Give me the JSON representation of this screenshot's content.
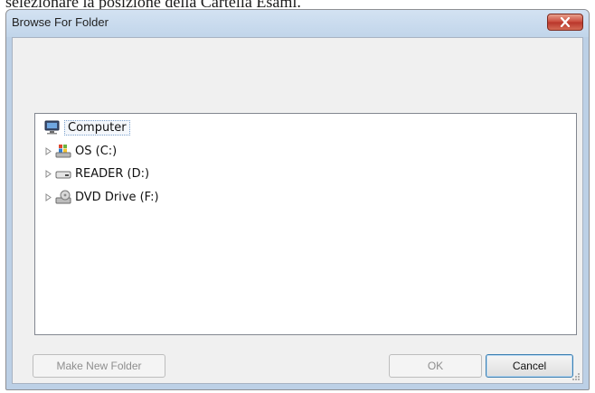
{
  "document": {
    "caption": "selezionare la posizione della Cartella Esami."
  },
  "dialog": {
    "title": "Browse For Folder",
    "tree": {
      "items": [
        {
          "label": "Computer",
          "icon": "computer-icon",
          "expandable": false,
          "selected": true
        },
        {
          "label": "OS (C:)",
          "icon": "windows-drive-icon",
          "expandable": true,
          "selected": false
        },
        {
          "label": "READER (D:)",
          "icon": "removable-drive-icon",
          "expandable": true,
          "selected": false
        },
        {
          "label": "DVD Drive (F:)",
          "icon": "dvd-drive-icon",
          "expandable": true,
          "selected": false
        }
      ]
    },
    "buttons": {
      "make_new_folder": "Make New Folder",
      "ok": "OK",
      "cancel": "Cancel"
    }
  }
}
